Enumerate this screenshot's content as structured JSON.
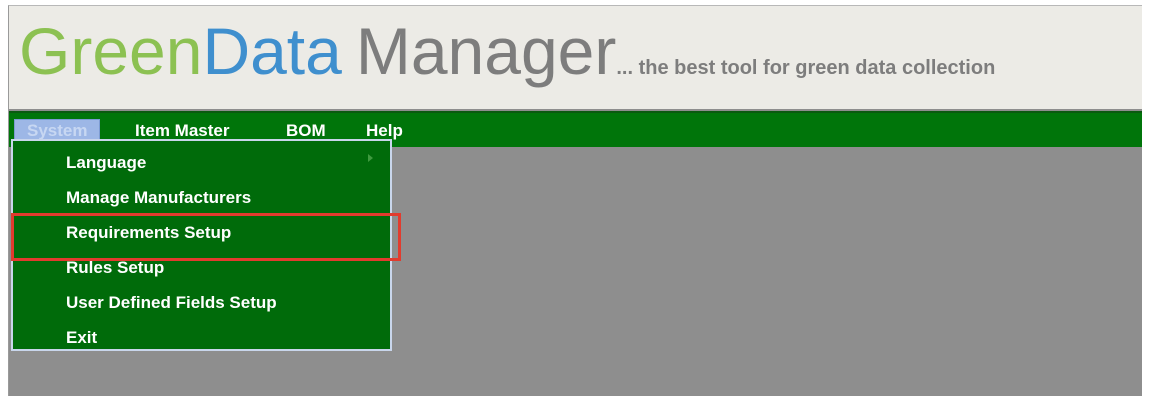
{
  "banner": {
    "logo_word1": "Green",
    "logo_word2": "Data",
    "logo_word3": "Manager",
    "tagline": "... the best tool for green data collection",
    "colors": {
      "green": "#8cc152",
      "blue": "#3f8fce",
      "gray": "#7d7d7d"
    }
  },
  "menubar": {
    "background": "#00750a",
    "items": [
      {
        "label": "System",
        "active": true
      },
      {
        "label": "Item Master",
        "active": false
      },
      {
        "label": "BOM",
        "active": false
      },
      {
        "label": "Help",
        "active": false
      }
    ]
  },
  "dropdown": {
    "items": [
      {
        "label": "Language",
        "has_submenu": true
      },
      {
        "label": "Manage Manufacturers",
        "has_submenu": false
      },
      {
        "label": "Requirements Setup",
        "has_submenu": false,
        "highlighted": true
      },
      {
        "label": "Rules Setup",
        "has_submenu": false
      },
      {
        "label": "User Defined Fields Setup",
        "has_submenu": false
      },
      {
        "label": "Exit",
        "has_submenu": false
      }
    ],
    "highlight_color": "#e23b2e"
  }
}
